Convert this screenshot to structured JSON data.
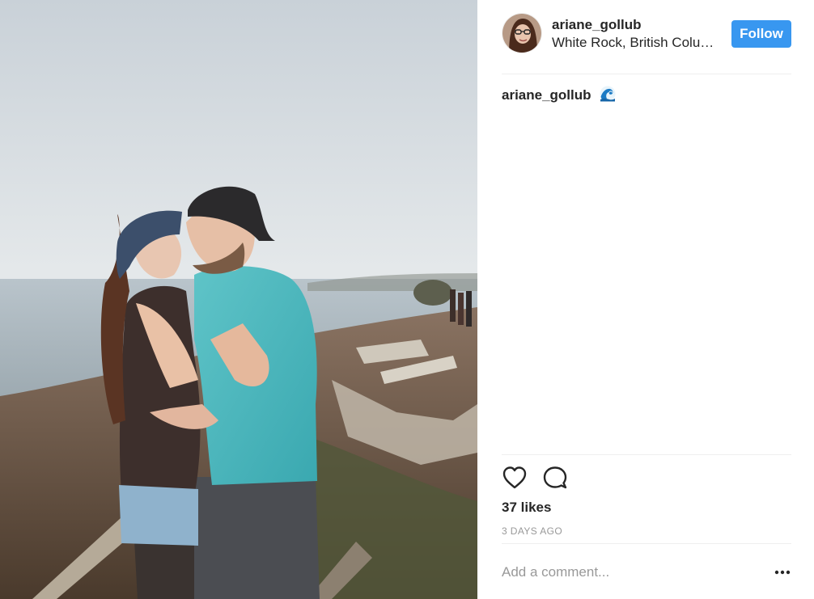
{
  "post": {
    "author": {
      "username": "ariane_gollub",
      "location": "White Rock, British Columbia"
    },
    "follow_label": "Follow",
    "caption": {
      "username": "ariane_gollub",
      "emoji_icon": "wave-emoji-icon"
    },
    "likes_text": "37 likes",
    "timestamp": "3 DAYS AGO",
    "comment_placeholder": "Add a comment...",
    "icons": [
      "heart-icon",
      "comment-icon",
      "more-options-icon"
    ]
  },
  "colors": {
    "follow_button": "#3897f0",
    "text": "#262626",
    "muted": "#999999",
    "divider": "#efefef"
  }
}
